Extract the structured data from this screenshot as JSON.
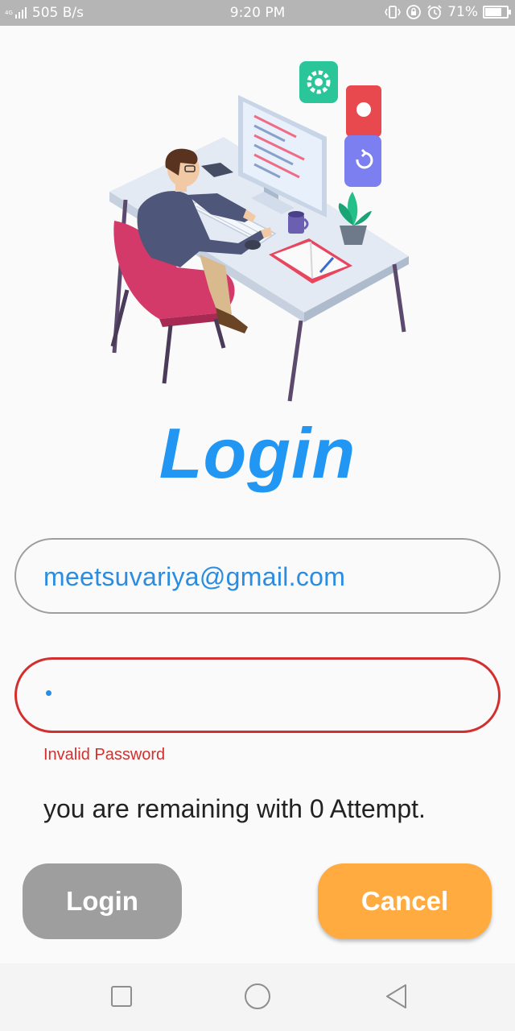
{
  "status_bar": {
    "network_tag": "4G",
    "speed": "505 B/s",
    "time": "9:20 PM",
    "battery_percent": "71%",
    "battery_level": 0.71,
    "color": "#b5b5b5"
  },
  "app": {
    "title": "Login",
    "title_color": "#2196f3"
  },
  "form": {
    "email": {
      "value": "meetsuvariya@gmail.com"
    },
    "password": {
      "masked_value": "•",
      "error": "Invalid Password",
      "error_color": "#d32f2f"
    },
    "attempts_message": "you are remaining with 0 Attempt."
  },
  "buttons": {
    "login_label": "Login",
    "login_color": "#9e9e9e",
    "cancel_label": "Cancel",
    "cancel_color": "#ffab40"
  },
  "nav_bar": {
    "icons": [
      "recent-apps-icon",
      "home-icon",
      "back-icon"
    ]
  }
}
